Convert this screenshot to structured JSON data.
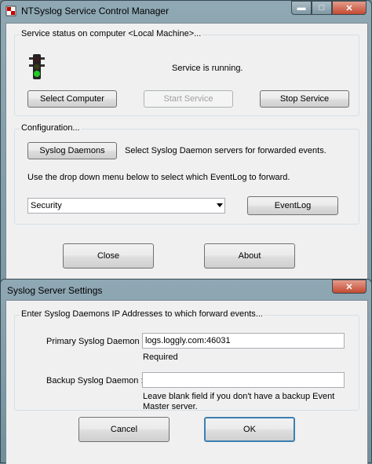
{
  "main_window": {
    "title": "NTSyslog Service Control Manager",
    "status_group": {
      "legend": "Service status on computer <Local Machine>...",
      "status_text": "Service is running.",
      "select_computer": "Select Computer",
      "start_service": "Start Service",
      "stop_service": "Stop Service"
    },
    "config_group": {
      "legend": "Configuration...",
      "syslog_daemons_button": "Syslog Daemons",
      "syslog_daemons_desc": "Select Syslog Daemon servers for forwarded events.",
      "dropdown_hint": "Use the drop down menu below to select which EventLog to forward.",
      "eventlog_selected": "Security",
      "eventlog_button": "EventLog"
    },
    "close_button": "Close",
    "about_button": "About"
  },
  "dialog": {
    "title": "Syslog Server Settings",
    "group_legend": "Enter Syslog Daemons IP Addresses to which forward events...",
    "primary_label": "Primary Syslog Daemon :",
    "primary_value": "logs.loggly.com:46031",
    "primary_note": "Required",
    "backup_label": "Backup Syslog Daemon :",
    "backup_value": "",
    "backup_note_line1": "Leave blank field if you don't have a backup Event",
    "backup_note_line2": "Master server.",
    "cancel_button": "Cancel",
    "ok_button": "OK"
  },
  "icons": {
    "app": "app-shield-icon",
    "status": "traffic-light-icon",
    "minimize": "minimize-icon",
    "maximize": "maximize-icon",
    "close": "close-icon"
  },
  "colors": {
    "traffic_green": "#22cc22",
    "close_red": "#c44a32",
    "focus_blue": "#3c7fb1"
  }
}
